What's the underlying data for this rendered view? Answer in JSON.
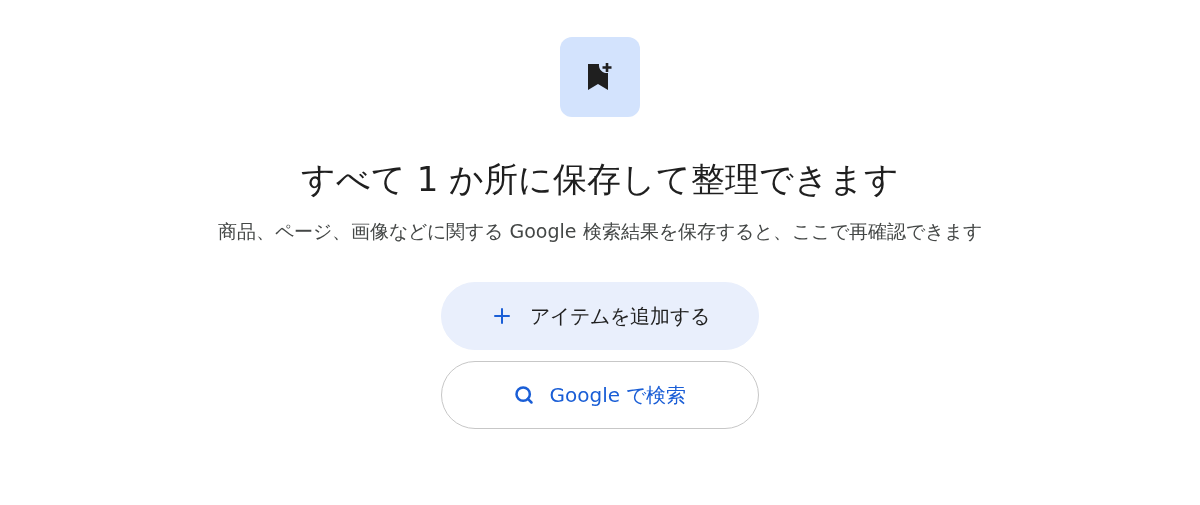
{
  "title": "すべて 1 か所に保存して整理できます",
  "description": "商品、ページ、画像などに関する Google 検索結果を保存すると、ここで再確認できます",
  "buttons": [
    {
      "label": "アイテムを追加する",
      "kind": "filled"
    },
    {
      "label": "Google で検索",
      "kind": "outlined"
    }
  ]
}
